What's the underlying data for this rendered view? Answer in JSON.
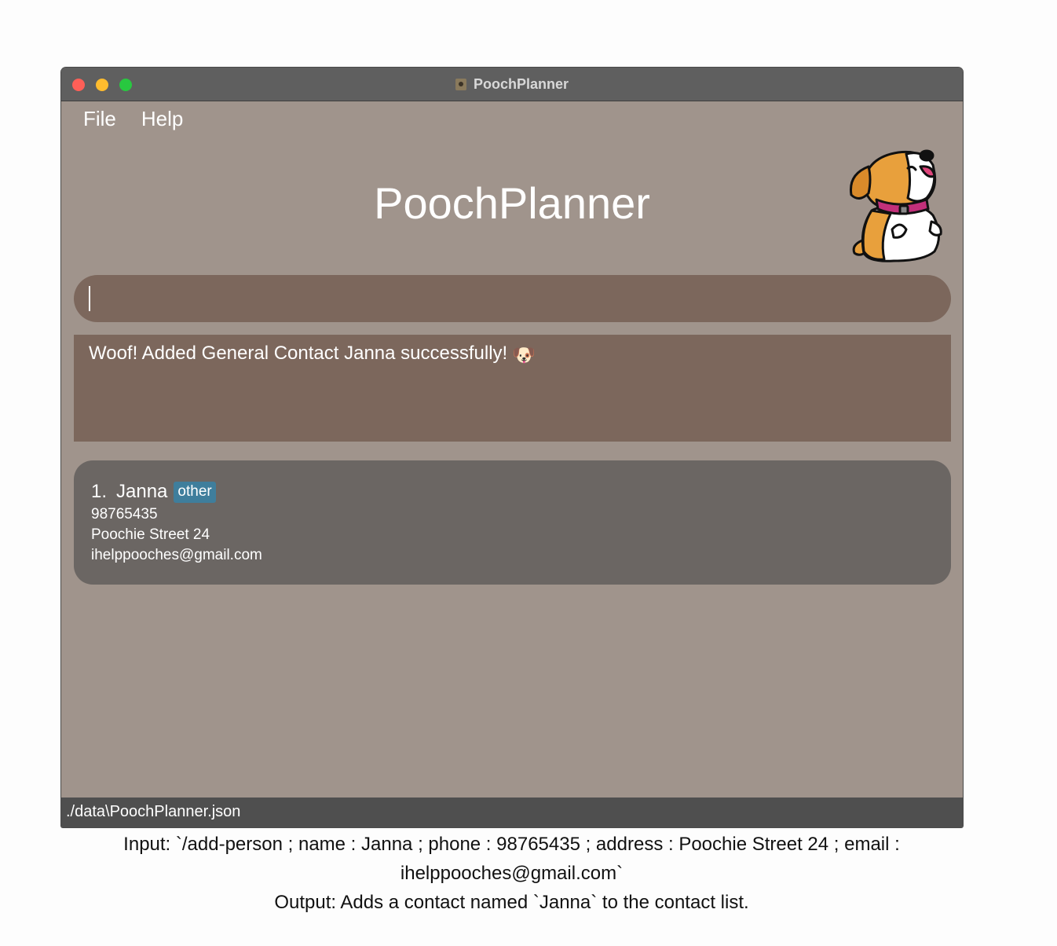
{
  "window": {
    "title": "PoochPlanner"
  },
  "menu": {
    "file": "File",
    "help": "Help"
  },
  "app": {
    "title": "PoochPlanner"
  },
  "command": {
    "value": ""
  },
  "result": {
    "message": "Woof! Added General Contact Janna successfully!",
    "emoji": "🐶"
  },
  "contacts": [
    {
      "index": "1.",
      "name": "Janna",
      "tag": "other",
      "phone": "98765435",
      "address": "Poochie Street 24",
      "email": "ihelppooches@gmail.com"
    }
  ],
  "status": {
    "path": "./data\\PoochPlanner.json"
  },
  "caption": {
    "input": "Input: `/add-person ; name : Janna ; phone : 98765435 ; address : Poochie Street 24 ; email : ihelppooches@gmail.com`",
    "output": "Output: Adds a contact named `Janna` to the contact list."
  },
  "colors": {
    "background": "#a0948c",
    "panel": "#7c675c",
    "card": "#6b6663",
    "tag": "#3f7e9c",
    "titlebar": "#5f5f5f",
    "statusbar": "#4f4f4f"
  }
}
